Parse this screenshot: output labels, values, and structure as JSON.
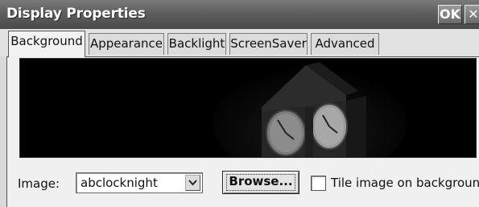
{
  "window": {
    "title": "Display Properties",
    "ok_label": "OK",
    "close_label": "✕"
  },
  "tabs": [
    {
      "label": "Background",
      "active": true
    },
    {
      "label": "Appearance",
      "active": false
    },
    {
      "label": "Backlight",
      "active": false
    },
    {
      "label": "ScreenSaver",
      "active": false
    },
    {
      "label": "Advanced",
      "active": false
    }
  ],
  "background_tab": {
    "preview_image": "clock-tower-night",
    "image_label": "Image:",
    "image_value": "abclocknight",
    "browse_label": "Browse...",
    "tile_label": "Tile image on background",
    "tile_checked": false
  },
  "icons": {
    "dropdown": "chevron-down-icon",
    "close": "close-icon"
  },
  "colors": {
    "titlebar": "#5e5e5e",
    "preview_bg": "#000000"
  }
}
